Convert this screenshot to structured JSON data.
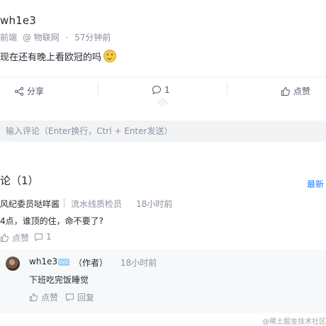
{
  "post": {
    "author": "wh1e3",
    "meta_group": "前端",
    "meta_topic": "@ 物联网",
    "meta_time": "57分钟前",
    "text": "现在还有晚上看欧冠的吗"
  },
  "actions": {
    "share": "分享",
    "comment_count": "1",
    "like": "点赞"
  },
  "comment_input": {
    "placeholder": "输入评论（Enter换行，Ctrl + Enter发送）"
  },
  "comments": {
    "title": "论（1）",
    "sort_latest": "最新",
    "items": [
      {
        "user": "风纪委员哒咩酱",
        "title": "流水线质检员",
        "time": "18小时前",
        "text": "4点，谁顶的住，命不要了?",
        "like": "点赞",
        "reply_count": "1",
        "replies": [
          {
            "user": "wh1e3",
            "level": "Lv1",
            "role": "（作者）",
            "time": "18小时前",
            "text": "下班吃完饭睡觉",
            "like": "点赞",
            "reply": "回复"
          }
        ]
      }
    ]
  },
  "watermark": "@稀土掘金技术社区"
}
